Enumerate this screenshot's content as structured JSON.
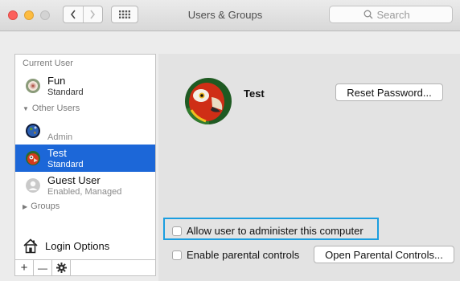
{
  "window": {
    "title": "Users & Groups"
  },
  "toolbar": {
    "search_placeholder": "Search",
    "back_icon": "chevron-left-icon",
    "forward_icon": "chevron-right-icon",
    "grid_icon": "grid-icon"
  },
  "sidebar": {
    "current_user_header": "Current User",
    "current_user": {
      "name": "Fun",
      "role": "Standard"
    },
    "other_users_header": "Other Users",
    "other_users": [
      {
        "name": "",
        "role": "Admin"
      },
      {
        "name": "Test",
        "role": "Standard",
        "selected": true
      },
      {
        "name": "Guest User",
        "role": "Enabled, Managed"
      }
    ],
    "groups_header": "Groups",
    "login_options": "Login Options",
    "add_label": "+",
    "remove_label": "—"
  },
  "main": {
    "user_name": "Test",
    "reset_password": "Reset Password...",
    "allow_admin": "Allow user to administer this computer",
    "enable_parental": "Enable parental controls",
    "open_parental": "Open Parental Controls..."
  },
  "colors": {
    "selection": "#1c67d8",
    "highlight_border": "#1b9ee0"
  }
}
